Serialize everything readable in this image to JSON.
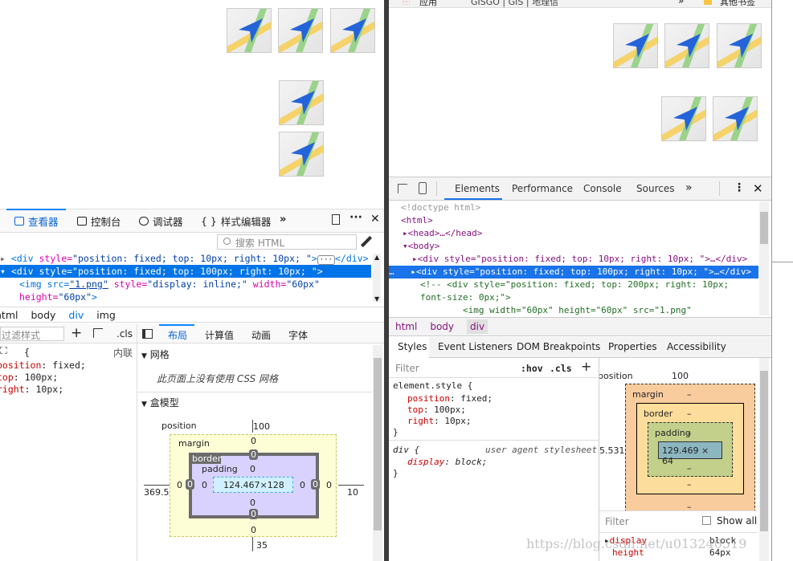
{
  "left_page": {
    "icons": [
      1,
      2,
      3,
      4,
      5
    ]
  },
  "firefox_devtools": {
    "tabs": [
      "查看器",
      "控制台",
      "调试器",
      "样式编辑器"
    ],
    "search_placeholder": "搜索 HTML",
    "html_lines": [
      {
        "tag": "<div",
        "attr": " style=",
        "val": "\"position: fixed; top: 10px; right: 10px; \"",
        "end": ">",
        "tail": "</div>"
      },
      {
        "tag": "<div",
        "attr": " style=",
        "val": "\"position: fixed; top: 100px; right: 10px; \"",
        "end": ">",
        "tail": ""
      },
      {
        "pre": "<img src=",
        "link": "\"1.png\"",
        "mid": " style=",
        "val": "\"display: inline;\"",
        "mid2": " width=",
        "val2": "\"60px\""
      },
      {
        "attr": "height=",
        "val": "\"60px\"",
        "end": ">"
      }
    ],
    "breadcrumb": [
      "html",
      "body",
      "div",
      "img"
    ],
    "filter_placeholder": "过滤样式",
    "cls_label": ".cls",
    "inline_label": "内联",
    "rule_open": "{",
    "rules": [
      {
        "prop": "position",
        "val": "fixed"
      },
      {
        "prop": "top",
        "val": "100px"
      },
      {
        "prop": "right",
        "val": "10px"
      }
    ],
    "layout_tabs": [
      "布局",
      "计算值",
      "动画",
      "字体"
    ],
    "grid_title": "网格",
    "grid_note": "此页面上没有使用 CSS 网格",
    "boxmodel_title": "盒模型",
    "boxmodel": {
      "position_label": "position",
      "position_top": "100",
      "position_bottom": "35",
      "position_left": "369.533",
      "position_right": "10",
      "margin_label": "margin",
      "margin_top": "0",
      "margin_bottom": "0",
      "margin_left": "0",
      "margin_right": "0",
      "border_label": "border",
      "border_top": "0",
      "border_bottom": "0",
      "border_left": "0",
      "border_right": "0",
      "padding_label": "padding",
      "padding_top": "0",
      "padding_bottom": "0",
      "padding_left": "0",
      "padding_right": "0",
      "content": "124.467×128"
    }
  },
  "chrome": {
    "bookmarks": [
      "应用",
      "GISGO | GIS | 地理信",
      "其他书签"
    ],
    "tabs": [
      "Elements",
      "Performance",
      "Console",
      "Sources"
    ],
    "html_lines": [
      "<!doctype html>",
      "<html>",
      "<head>…</head>",
      "<body>",
      "<div style=\"position: fixed; top: 10px; right: 10px; \">…</div>",
      "<div style=\"position: fixed; top: 100px; right: 10px; \">…</div>",
      "<!-- <div style=\"position: fixed; top: 200px; right: 10px;",
      "font-size: 0px;\">",
      "<img width=\"60px\" height=\"60px\" src=\"1.png\""
    ],
    "breadcrumb": [
      "html",
      "body",
      "div"
    ],
    "subtabs": [
      "Styles",
      "Event Listeners",
      "DOM Breakpoints",
      "Properties",
      "Accessibility"
    ],
    "filter_placeholder": "Filter",
    "hov": ":hov",
    "cls": ".cls",
    "element_style": "element.style {",
    "rules": [
      {
        "prop": "position",
        "val": "fixed"
      },
      {
        "prop": "top",
        "val": "100px"
      },
      {
        "prop": "right",
        "val": "10px"
      }
    ],
    "close_brace": "}",
    "ua_selector": "div {",
    "ua_label": "user agent stylesheet",
    "ua_rule": {
      "prop": "display",
      "val": "block"
    },
    "boxmodel": {
      "position_label": "position",
      "position_top": "100",
      "position_left": "5.531",
      "margin_label": "margin",
      "margin_top": "–",
      "margin_bottom": "–",
      "border_label": "border",
      "border_top": "–",
      "border_bottom": "–",
      "padding_label": "padding",
      "padding_top": "–",
      "padding_bottom": "–",
      "content": "129.469 × 64",
      "side_dash": "–"
    },
    "computed_filter": "Filter",
    "show_all": "Show all",
    "computed": [
      {
        "prop": "display",
        "val": "block"
      },
      {
        "prop": "height",
        "val": "64px"
      }
    ]
  },
  "watermark": "https://blog.csdn.net/u013240519"
}
